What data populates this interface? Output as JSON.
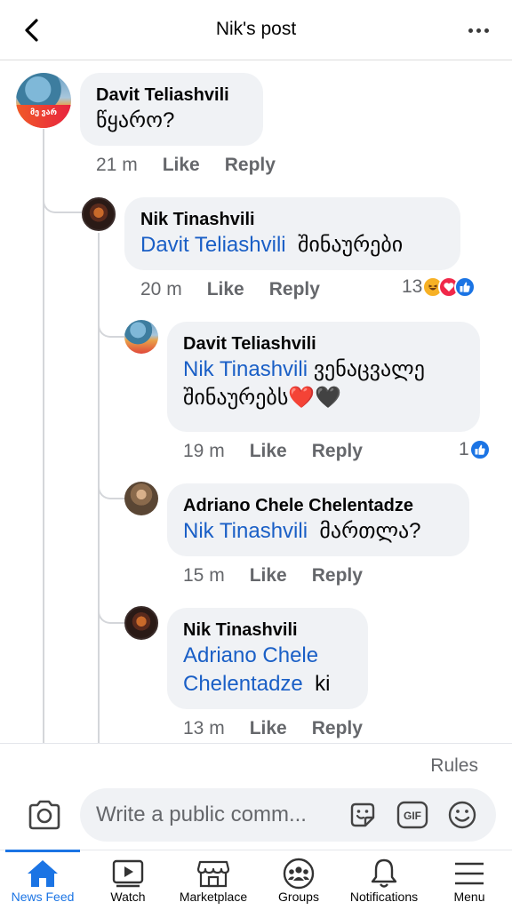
{
  "header": {
    "title": "Nik's post"
  },
  "comments": [
    {
      "author": "Davit Teliashvili",
      "text": "წყარო?",
      "time": "21 m",
      "like": "Like",
      "reply": "Reply",
      "avatar_badge": "მე ვარ"
    },
    {
      "author": "Nik Tinashvili",
      "mention": "Davit Teliashvili",
      "text": "შინაურები",
      "time": "20 m",
      "like": "Like",
      "reply": "Reply",
      "reaction_count": "13",
      "reactions": [
        "haha",
        "love",
        "like"
      ]
    },
    {
      "author": "Davit Teliashvili",
      "mention": "Nik Tinashvili",
      "text_line1": "ვენაცვალე",
      "text_line2": "შინაურებს",
      "emoji": "❤️🖤",
      "time": "19 m",
      "like": "Like",
      "reply": "Reply",
      "reaction_count": "1",
      "reactions": [
        "like"
      ]
    },
    {
      "author": "Adriano Chele Chelentadze",
      "mention": "Nik Tinashvili",
      "text": "მართლა?",
      "time": "15 m",
      "like": "Like",
      "reply": "Reply"
    },
    {
      "author": "Nik Tinashvili",
      "mention_line1": "Adriano Chele",
      "mention_line2": "Chelentadze",
      "text": "ki",
      "time": "13 m",
      "like": "Like",
      "reply": "Reply"
    }
  ],
  "composer": {
    "rules": "Rules",
    "placeholder": "Write a public comm..."
  },
  "nav": {
    "items": [
      {
        "label": "News Feed",
        "icon": "home-icon",
        "active": true
      },
      {
        "label": "Watch",
        "icon": "watch-icon"
      },
      {
        "label": "Marketplace",
        "icon": "marketplace-icon"
      },
      {
        "label": "Groups",
        "icon": "groups-icon"
      },
      {
        "label": "Notifications",
        "icon": "bell-icon"
      },
      {
        "label": "Menu",
        "icon": "menu-icon"
      }
    ]
  },
  "colors": {
    "accent": "#1b74e4",
    "mention": "#1a5fc6",
    "bubble": "#f0f2f5",
    "secondary_text": "#65676b"
  }
}
